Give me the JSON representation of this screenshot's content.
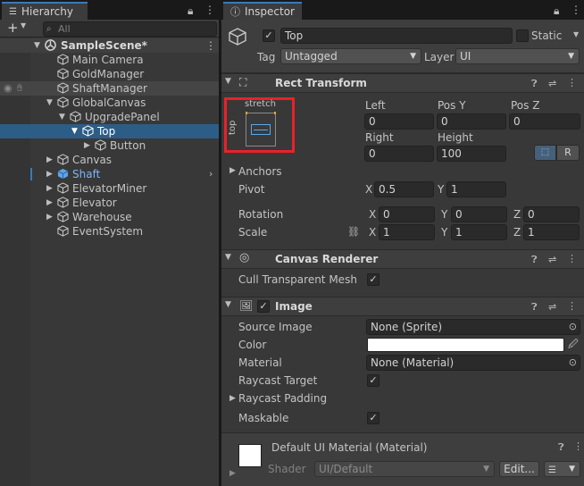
{
  "hierarchy": {
    "tab_title": "Hierarchy",
    "search_placeholder": "All",
    "items": [
      {
        "label": "SampleScene*"
      },
      {
        "label": "Main Camera"
      },
      {
        "label": "GoldManager"
      },
      {
        "label": "ShaftManager"
      },
      {
        "label": "GlobalCanvas"
      },
      {
        "label": "UpgradePanel"
      },
      {
        "label": "Top"
      },
      {
        "label": "Button"
      },
      {
        "label": "Canvas"
      },
      {
        "label": "Shaft"
      },
      {
        "label": "ElevatorMiner"
      },
      {
        "label": "Elevator"
      },
      {
        "label": "Warehouse"
      },
      {
        "label": "EventSystem"
      }
    ]
  },
  "inspector": {
    "tab_title": "Inspector",
    "object_name": "Top",
    "static_label": "Static",
    "tag_label": "Tag",
    "tag_value": "Untagged",
    "layer_label": "Layer",
    "layer_value": "UI",
    "rect_transform": {
      "title": "Rect Transform",
      "anchor_preset_top": "stretch",
      "anchor_preset_side": "top",
      "left_label": "Left",
      "left_value": "0",
      "posy_label": "Pos Y",
      "posy_value": "0",
      "posz_label": "Pos Z",
      "posz_value": "0",
      "right_label": "Right",
      "right_value": "0",
      "height_label": "Height",
      "height_value": "100",
      "r_button": "R",
      "anchors_label": "Anchors",
      "pivot_label": "Pivot",
      "pivot_x": "0.5",
      "pivot_y": "1",
      "rotation_label": "Rotation",
      "rot_x": "0",
      "rot_y": "0",
      "rot_z": "0",
      "scale_label": "Scale",
      "scale_x": "1",
      "scale_y": "1",
      "scale_z": "1",
      "x": "X",
      "y": "Y",
      "z": "Z"
    },
    "canvas_renderer": {
      "title": "Canvas Renderer",
      "cull_label": "Cull Transparent Mesh"
    },
    "image": {
      "title": "Image",
      "source_image_label": "Source Image",
      "source_image_value": "None (Sprite)",
      "color_label": "Color",
      "material_label": "Material",
      "material_value": "None (Material)",
      "raycast_target_label": "Raycast Target",
      "raycast_padding_label": "Raycast Padding",
      "maskable_label": "Maskable"
    },
    "material": {
      "title": "Default UI Material (Material)",
      "shader_label": "Shader",
      "shader_value": "UI/Default",
      "edit_button": "Edit..."
    }
  },
  "colors": {
    "selection": "#2c5d87",
    "highlight_red": "#e8222a",
    "prefab_blue": "#7cb6ff"
  }
}
